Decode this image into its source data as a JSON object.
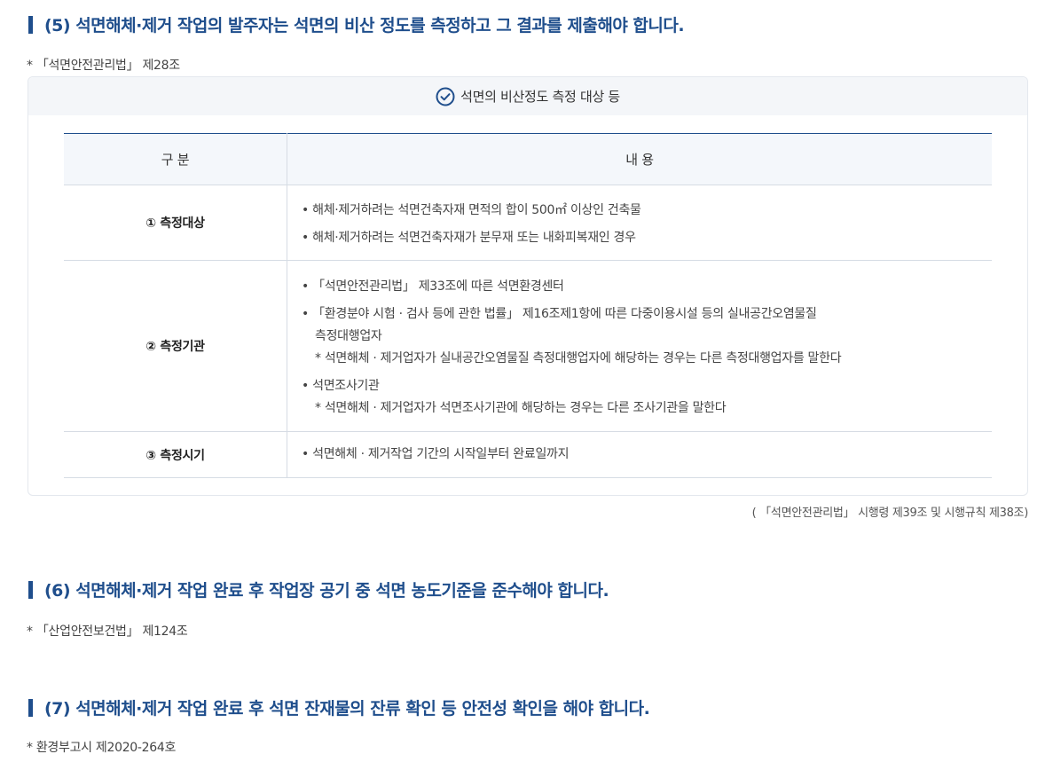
{
  "sections": [
    {
      "heading": "(5) 석면해체·제거 작업의 발주자는 석면의 비산 정도를 측정하고 그 결과를 제출해야 합니다.",
      "ref": "* 「석면안전관리법」 제28조"
    },
    {
      "heading": "(6) 석면해체·제거 작업 완료 후 작업장 공기 중 석면 농도기준을 준수해야 합니다.",
      "ref": "* 「산업안전보건법」 제124조"
    },
    {
      "heading": "(7) 석면해체·제거 작업 완료 후 석면 잔재물의 잔류 확인 등 안전성 확인을 해야 합니다.",
      "ref": "* 환경부고시 제2020-264호"
    }
  ],
  "box": {
    "title": "석면의 비산정도 측정 대상 등",
    "icon": "check-circle-icon",
    "table": {
      "headers": [
        "구 분",
        "내 용"
      ],
      "rows": [
        {
          "label": "① 측정대상",
          "lines": [
            "• 해체·제거하려는 석면건축자재 면적의 합이 500㎡ 이상인 건축물",
            "•  해체·제거하려는 석면건축자재가 분무재 또는 내화피복재인 경우"
          ]
        },
        {
          "label": "② 측정기관",
          "lines": [
            "• 「석면안전관리법」 제33조에 따른 석면환경센터",
            "• 「환경분야 시험 · 검사 등에 관한 법률」 제16조제1항에 따른 다중이용시설 등의 실내공간오염물질",
            "측정대행업자",
            "* 석면해체 · 제거업자가 실내공간오염물질 측정대행업자에 해당하는 경우는 다른 측정대행업자를 말한다",
            "• 석면조사기관",
            "* 석면해체 · 제거업자가 석면조사기관에 해당하는 경우는 다른 조사기관을 말한다"
          ]
        },
        {
          "label": "③ 측정시기",
          "lines": [
            "• 석면해체 · 제거작업 기간의 시작일부터 완료일까지"
          ]
        }
      ]
    },
    "source": "( 「석면안전관리법」 시행령 제39조 및 시행규칙 제38조)"
  },
  "colors": {
    "accent": "#1f4e8c",
    "header_bg": "#f4f6f9",
    "border": "#d6dce4"
  }
}
